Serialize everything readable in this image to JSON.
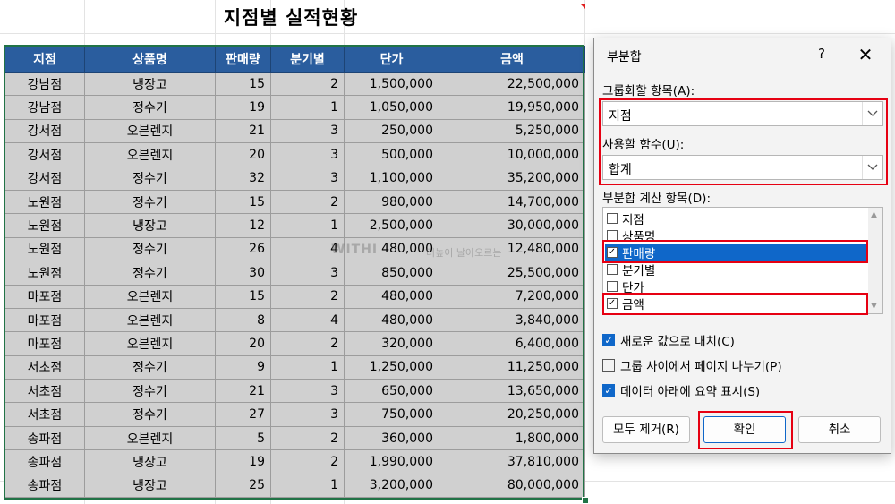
{
  "sheet": {
    "title": "지점별 실적현황",
    "watermark": "WITHI",
    "watermark_sub": "더높이 날아오르는",
    "headers": [
      "지점",
      "상품명",
      "판매량",
      "분기별",
      "단가",
      "금액"
    ],
    "rows": [
      [
        "강남점",
        "냉장고",
        "15",
        "2",
        "1,500,000",
        "22,500,000"
      ],
      [
        "강남점",
        "정수기",
        "19",
        "1",
        "1,050,000",
        "19,950,000"
      ],
      [
        "강서점",
        "오븐렌지",
        "21",
        "3",
        "250,000",
        "5,250,000"
      ],
      [
        "강서점",
        "오븐렌지",
        "20",
        "3",
        "500,000",
        "10,000,000"
      ],
      [
        "강서점",
        "정수기",
        "32",
        "3",
        "1,100,000",
        "35,200,000"
      ],
      [
        "노원점",
        "정수기",
        "15",
        "2",
        "980,000",
        "14,700,000"
      ],
      [
        "노원점",
        "냉장고",
        "12",
        "1",
        "2,500,000",
        "30,000,000"
      ],
      [
        "노원점",
        "정수기",
        "26",
        "4",
        "480,000",
        "12,480,000"
      ],
      [
        "노원점",
        "정수기",
        "30",
        "3",
        "850,000",
        "25,500,000"
      ],
      [
        "마포점",
        "오븐렌지",
        "15",
        "2",
        "480,000",
        "7,200,000"
      ],
      [
        "마포점",
        "오븐렌지",
        "8",
        "4",
        "480,000",
        "3,840,000"
      ],
      [
        "마포점",
        "오븐렌지",
        "20",
        "2",
        "320,000",
        "6,400,000"
      ],
      [
        "서초점",
        "정수기",
        "9",
        "1",
        "1,250,000",
        "11,250,000"
      ],
      [
        "서초점",
        "정수기",
        "21",
        "3",
        "650,000",
        "13,650,000"
      ],
      [
        "서초점",
        "정수기",
        "27",
        "3",
        "750,000",
        "20,250,000"
      ],
      [
        "송파점",
        "오븐렌지",
        "5",
        "2",
        "360,000",
        "1,800,000"
      ],
      [
        "송파점",
        "냉장고",
        "19",
        "2",
        "1,990,000",
        "37,810,000"
      ],
      [
        "송파점",
        "냉장고",
        "25",
        "1",
        "3,200,000",
        "80,000,000"
      ]
    ]
  },
  "dialog": {
    "title": "부분합",
    "help": "?",
    "close": "✕",
    "group_label": "그룹화할 항목(A):",
    "group_value": "지점",
    "func_label": "사용할 함수(U):",
    "func_value": "합계",
    "calc_label": "부분합 계산 항목(D):",
    "calc_items": [
      {
        "label": "지점",
        "checked": false,
        "selected": false
      },
      {
        "label": "상품명",
        "checked": false,
        "selected": false
      },
      {
        "label": "판매량",
        "checked": true,
        "selected": true
      },
      {
        "label": "분기별",
        "checked": false,
        "selected": false
      },
      {
        "label": "단가",
        "checked": false,
        "selected": false
      },
      {
        "label": "금액",
        "checked": true,
        "selected": false
      }
    ],
    "opt_replace": "새로운 값으로 대치(C)",
    "opt_replace_checked": true,
    "opt_pagebreak": "그룹 사이에서 페이지 나누기(P)",
    "opt_pagebreak_checked": false,
    "opt_summary": "데이터 아래에 요약 표시(S)",
    "opt_summary_checked": true,
    "btn_remove": "모두 제거(R)",
    "btn_ok": "확인",
    "btn_cancel": "취소",
    "highlight_color": "#e60012",
    "accent_color": "#0f67c9",
    "header_color": "#2a5d9e"
  }
}
